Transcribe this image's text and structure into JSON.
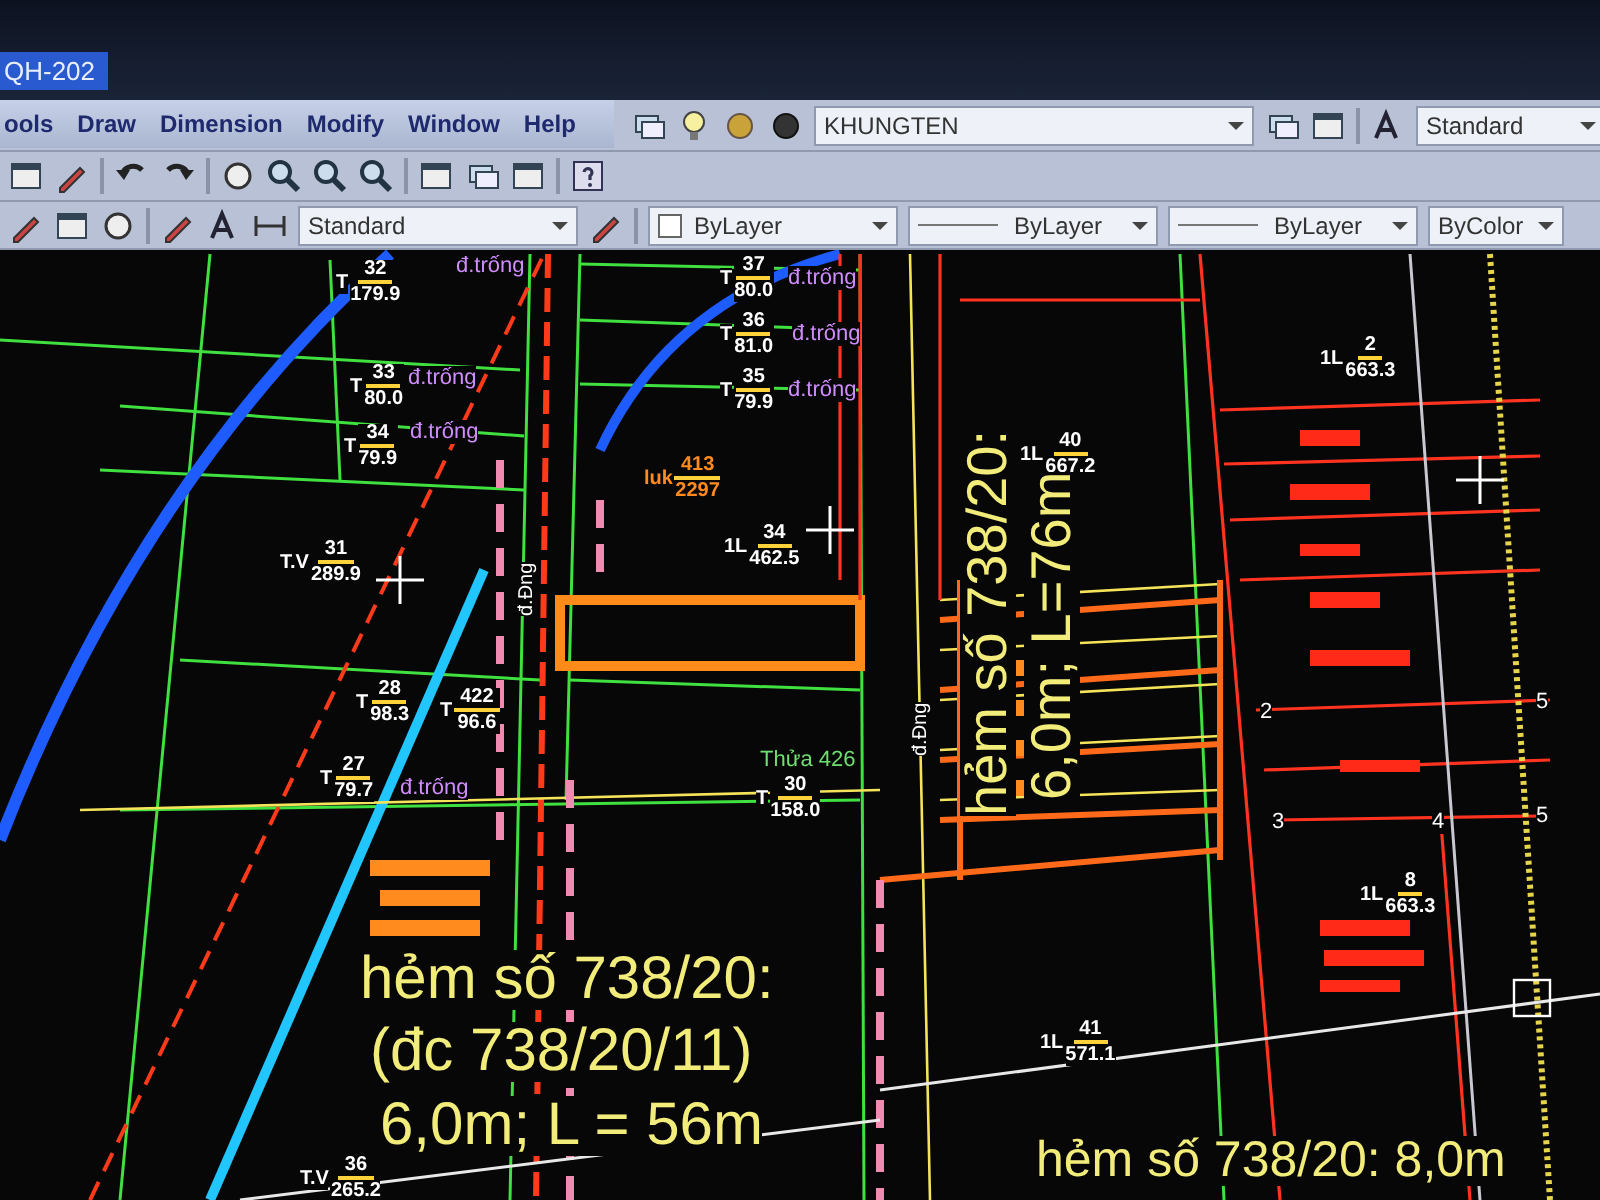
{
  "window": {
    "title": "QH-202"
  },
  "menu": [
    {
      "label": "ools"
    },
    {
      "label": "Draw"
    },
    {
      "label": "Dimension"
    },
    {
      "label": "Modify"
    },
    {
      "label": "Window"
    },
    {
      "label": "Help"
    }
  ],
  "layer_toolbar": {
    "layer": "KHUNGTEN",
    "text_style": "Standard"
  },
  "properties_toolbar": {
    "dim_style": "Standard",
    "color_setting": "ByLayer",
    "linetype": "ByLayer",
    "lineweight": "ByLayer",
    "plot_style": "ByColor"
  },
  "drawing": {
    "parcels": [
      {
        "prefix": "T",
        "number": "32",
        "area": "179.9",
        "color": "#ffffff"
      },
      {
        "prefix": "T",
        "number": "33",
        "area": "80.0",
        "color": "#ffffff"
      },
      {
        "prefix": "T",
        "number": "34",
        "area": "79.9",
        "color": "#ffffff"
      },
      {
        "prefix": "T.V",
        "number": "31",
        "area": "289.9",
        "color": "#ffffff"
      },
      {
        "prefix": "T",
        "number": "37",
        "area": "80.0",
        "color": "#ffffff"
      },
      {
        "prefix": "T",
        "number": "36",
        "area": "81.0",
        "color": "#ffffff"
      },
      {
        "prefix": "T",
        "number": "35",
        "area": "79.9",
        "color": "#ffffff"
      },
      {
        "prefix": "luk",
        "number": "413",
        "area": "2297",
        "color": "#ff8a1e"
      },
      {
        "prefix": "1L",
        "number": "34",
        "area": "462.5",
        "color": "#ffffff"
      },
      {
        "prefix": "T",
        "number": "28",
        "area": "98.3",
        "color": "#ffffff"
      },
      {
        "prefix": "T",
        "number": "422",
        "area": "96.6",
        "color": "#ffffff"
      },
      {
        "prefix": "T",
        "number": "27",
        "area": "79.7",
        "color": "#ffffff"
      },
      {
        "prefix": "T",
        "number": "30",
        "area": "158.0",
        "color": "#ffffff"
      },
      {
        "prefix": "1L",
        "number": "40",
        "area": "667.2",
        "color": "#ffffff"
      },
      {
        "prefix": "1L",
        "number": "2",
        "area": "663.3",
        "color": "#ffffff"
      },
      {
        "prefix": "1L",
        "number": "8",
        "area": "663.3",
        "color": "#ffffff"
      },
      {
        "prefix": "1L",
        "number": "41",
        "area": "571.1",
        "color": "#ffffff"
      },
      {
        "prefix": "T.V",
        "number": "36",
        "area": "265.2",
        "color": "#ffffff"
      }
    ],
    "notes": [
      {
        "text": "đ.trống"
      },
      {
        "text": "đ.trống"
      },
      {
        "text": "đ.trống"
      },
      {
        "text": "đ.trống"
      },
      {
        "text": "đ.trống"
      },
      {
        "text": "đ.trống"
      },
      {
        "text": "đ.trống"
      },
      {
        "text": "Thửa 426"
      },
      {
        "text": "đ.Đng"
      },
      {
        "text": "đ.Đng"
      }
    ],
    "road_labels": [
      {
        "text": "hẻm số 738/20:"
      },
      {
        "text": "(đc 738/20/11)"
      },
      {
        "text": "6,0m; L = 56m"
      },
      {
        "text": "hẻm số 738/20:"
      },
      {
        "text": "6,0m; L=76m"
      },
      {
        "text": "hẻm số 738/20: 8,0m"
      }
    ],
    "vertex_numbers": [
      {
        "text": "2"
      },
      {
        "text": "5"
      },
      {
        "text": "3"
      },
      {
        "text": "4"
      },
      {
        "text": "5"
      }
    ]
  }
}
